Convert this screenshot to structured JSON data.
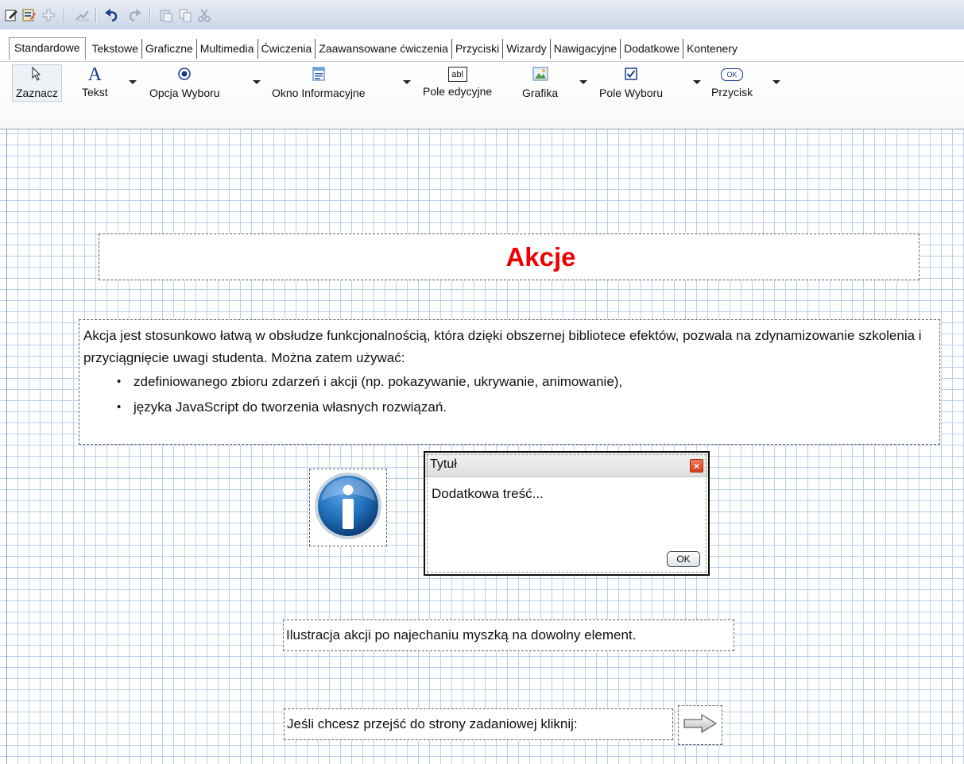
{
  "toolbar": {
    "icons": [
      "edit-page-icon",
      "edit-properties-icon",
      "add-icon",
      "publish-icon",
      "undo-icon",
      "redo-icon",
      "paste-icon",
      "copy-icon",
      "cut-icon"
    ]
  },
  "tabs": [
    {
      "label": "Standardowe",
      "active": true
    },
    {
      "label": "Tekstowe"
    },
    {
      "label": "Graficzne"
    },
    {
      "label": "Multimedia"
    },
    {
      "label": "Ćwiczenia"
    },
    {
      "label": "Zaawansowane ćwiczenia"
    },
    {
      "label": "Przyciski"
    },
    {
      "label": "Wizardy"
    },
    {
      "label": "Nawigacyjne"
    },
    {
      "label": "Dodatkowe"
    },
    {
      "label": "Kontenery"
    }
  ],
  "palette": {
    "zaznacz": "Zaznacz",
    "tekst": "Tekst",
    "opcja_wyboru": "Opcja Wyboru",
    "okno_informacyjne": "Okno Informacyjne",
    "pole_edycyjne": "Pole edycyjne",
    "grafika": "Grafika",
    "pole_wyboru": "Pole Wyboru",
    "przycisk": "Przycisk",
    "tekst_icon_glyph": "A",
    "edit_icon_glyph": "abl",
    "button_icon_glyph": "OK"
  },
  "page": {
    "title": "Akcje",
    "description": "Akcja jest stosunkowo łatwą w obsłudze funkcjonalnością, która dzięki obszernej bibliotece efektów, pozwala na zdynamizowanie szkolenia i przyciągnięcie uwagi studenta. Można zatem używać:",
    "bullets": [
      "zdefiniowanego zbioru zdarzeń i akcji (np. pokazywanie, ukrywanie, animowanie),",
      "języka JavaScript do tworzenia własnych rozwiązań."
    ],
    "illustration_caption": "Ilustracja akcji po najechaniu myszką na dowolny element.",
    "goto_text": "Jeśli chcesz przejść do strony zadaniowej kliknij:"
  },
  "dialog": {
    "title": "Tytuł",
    "close_glyph": "×",
    "body": "Dodatkowa treść...",
    "ok_label": "OK"
  },
  "colors": {
    "title_red": "#ee0000",
    "grid_minor": "#bcd0ea",
    "grid_major": "#8fb0d8",
    "info_blue": "#1f6fb8"
  }
}
